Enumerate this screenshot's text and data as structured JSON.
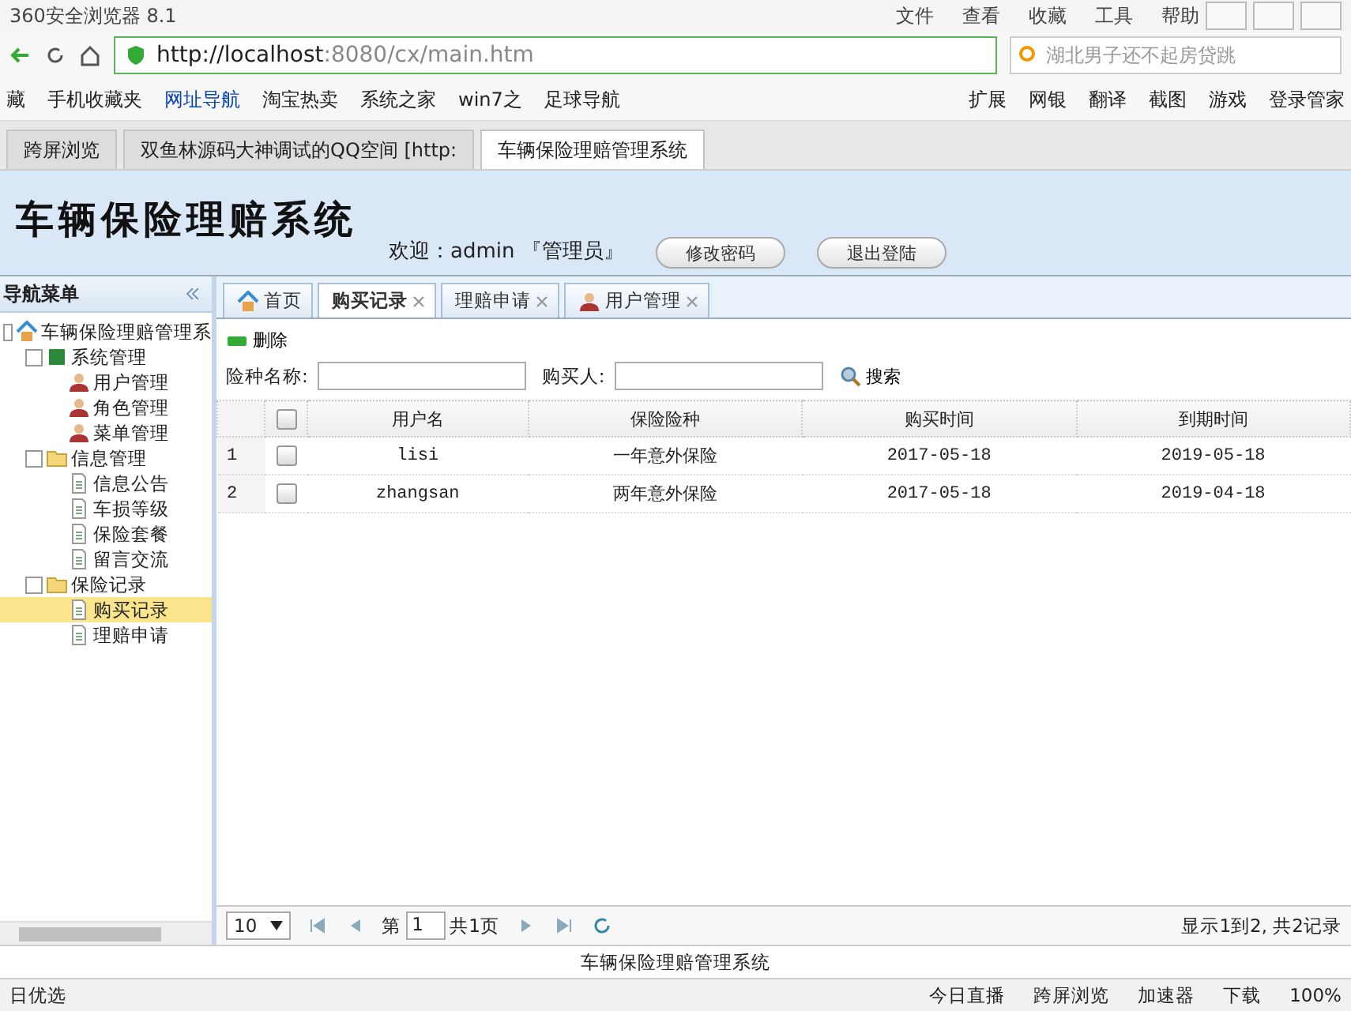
{
  "browser": {
    "title": "360安全浏览器 8.1",
    "menu": [
      "文件",
      "查看",
      "收藏",
      "工具",
      "帮助"
    ],
    "url_host": "http://localhost",
    "url_rest": ":8080/cx/main.htm",
    "search_text": "湖北男子还不起房贷跳",
    "bookmarks": [
      "藏",
      "手机收藏夹",
      "网址导航",
      "淘宝热卖",
      "系统之家",
      "win7之",
      "足球导航"
    ],
    "tools": [
      "扩展",
      "网银",
      "翻译",
      "截图",
      "游戏",
      "登录管家"
    ],
    "tabs": [
      {
        "label": "跨屏浏览",
        "selected": false
      },
      {
        "label": "双鱼林源码大神调试的QQ空间 [http:",
        "selected": false
      },
      {
        "label": "车辆保险理赔管理系统",
        "selected": true
      }
    ],
    "status": [
      "日优选",
      "今日直播",
      "跨屏浏览",
      "加速器",
      "下载",
      "100%"
    ]
  },
  "app": {
    "title": "车辆保险理赔系统",
    "welcome": "欢迎：admin 『管理员』",
    "buttons": [
      "修改密码",
      "退出登陆"
    ],
    "nav_title": "导航菜单",
    "tree": [
      {
        "label": "车辆保险理赔管理系",
        "selected": false,
        "children": [
          {
            "label": "系统管理",
            "selected": false,
            "children": [
              {
                "label": "用户管理",
                "selected": false
              },
              {
                "label": "角色管理",
                "selected": false
              },
              {
                "label": "菜单管理",
                "selected": false
              }
            ]
          },
          {
            "label": "信息管理",
            "selected": false,
            "children": [
              {
                "label": "信息公告",
                "selected": false
              },
              {
                "label": "车损等级",
                "selected": false
              },
              {
                "label": "保险套餐",
                "selected": false
              },
              {
                "label": "留言交流",
                "selected": false
              }
            ]
          },
          {
            "label": "保险记录",
            "selected": false,
            "children": [
              {
                "label": "购买记录",
                "selected": true
              },
              {
                "label": "理赔申请",
                "selected": false
              }
            ]
          }
        ]
      }
    ],
    "tabs": [
      {
        "label": "首页",
        "selected": false,
        "closable": false
      },
      {
        "label": "购买记录",
        "selected": true,
        "closable": true
      },
      {
        "label": "理赔申请",
        "selected": false,
        "closable": true
      },
      {
        "label": "用户管理",
        "selected": false,
        "closable": true
      }
    ],
    "delete_label": "删除",
    "filters": [
      {
        "label": "险种名称:"
      },
      {
        "label": "购买人:"
      }
    ],
    "search_label": "搜索",
    "all_checked": false,
    "columns": [
      "用户名",
      "保险险种",
      "购买时间",
      "到期时间"
    ],
    "rows": [
      {
        "index": "1",
        "checked": false,
        "cells": [
          "lisi",
          "一年意外保险",
          "2017-05-18",
          "2019-05-18"
        ]
      },
      {
        "index": "2",
        "checked": false,
        "cells": [
          "zhangsan",
          "两年意外保险",
          "2017-05-18",
          "2019-04-18"
        ]
      }
    ],
    "pager": {
      "page_size": "10",
      "page_prefix": "第",
      "page": "1",
      "page_total": "共1页",
      "summary": "显示1到2, 共2记录"
    },
    "footer": "车辆保险理赔管理系统"
  }
}
